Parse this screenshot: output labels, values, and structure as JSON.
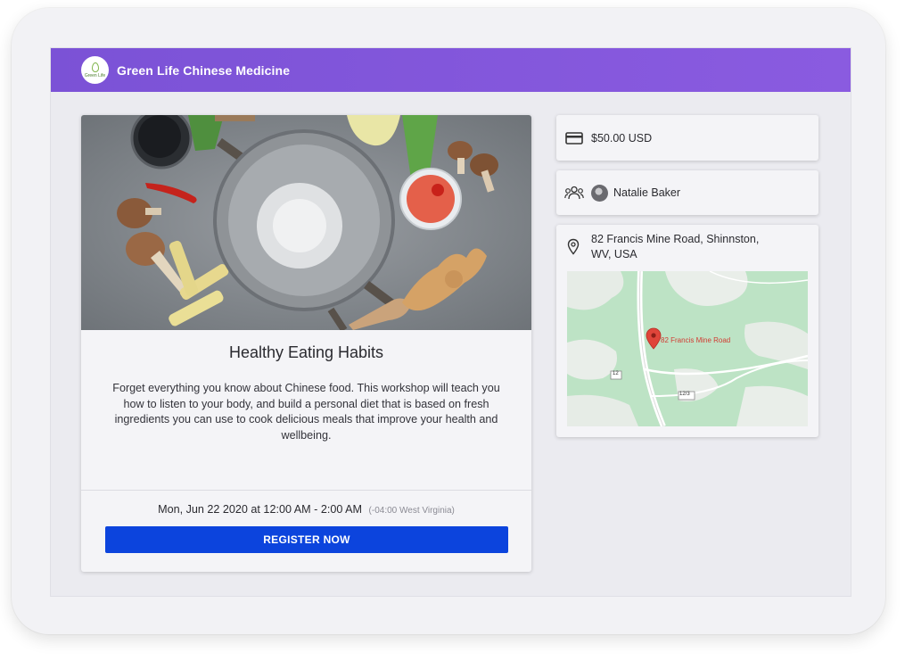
{
  "header": {
    "brand_name": "Green Life Chinese Medicine",
    "logo_text": "Green Life"
  },
  "event": {
    "image_icon": "cooking-ingredients-photo",
    "title": "Healthy Eating Habits",
    "description": "Forget everything you know about Chinese food. This workshop will teach you how to listen to your body, and build a personal diet that is based on fresh ingredients you can use to cook delicious meals that improve your health and wellbeing.",
    "datetime": "Mon, Jun 22 2020 at 12:00 AM - 2:00 AM",
    "timezone": "(-04:00 West Virginia)",
    "register_label": "REGISTER NOW"
  },
  "price": {
    "icon": "credit-card-icon",
    "value": "$50.00 USD"
  },
  "host": {
    "icon": "people-icon",
    "name": "Natalie Baker"
  },
  "location": {
    "icon": "map-pin-icon",
    "address_line1": "82 Francis Mine Road, Shinnston,",
    "address_line2": "WV, USA",
    "map_marker_label": "82 Francis Mine Road",
    "road_shields": [
      "12",
      "12/3"
    ]
  },
  "colors": {
    "header": "#7b52d6",
    "button": "#0c44dd",
    "marker": "#e0453a",
    "map_green": "#b9e0c2"
  }
}
